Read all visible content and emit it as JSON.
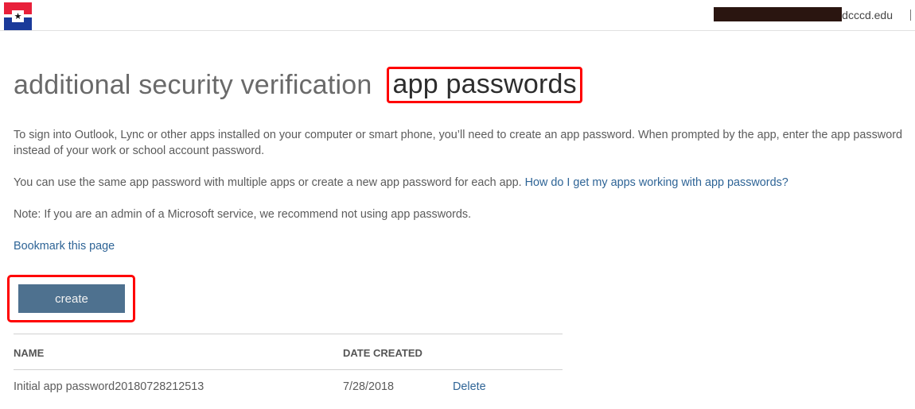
{
  "header": {
    "logo": "college-flag-logo",
    "user_domain": "dcccd.edu",
    "user_redacted": true,
    "separator": "|"
  },
  "page": {
    "title": "additional security verification",
    "subtitle": "app passwords"
  },
  "content": {
    "paragraph1": "To sign into Outlook, Lync or other apps installed on your computer or smart phone, you’ll need to create an app password. When prompted by the app, enter the app password instead of your work or school account password.",
    "paragraph2_text": "You can use the same app password with multiple apps or create a new app password for each app. ",
    "paragraph2_link": "How do I get my apps working with app passwords?",
    "note": "Note: If you are an admin of a Microsoft service, we recommend not using app passwords.",
    "bookmark_link": "Bookmark this page"
  },
  "actions": {
    "create_label": "create"
  },
  "table": {
    "columns": [
      "NAME",
      "DATE CREATED"
    ],
    "rows": [
      {
        "name": "Initial app password20180728212513",
        "date_created": "7/28/2018",
        "action": "Delete"
      }
    ]
  },
  "colors": {
    "accent_button": "#4e718f",
    "link": "#2e6496",
    "highlight": "#ff0000"
  }
}
